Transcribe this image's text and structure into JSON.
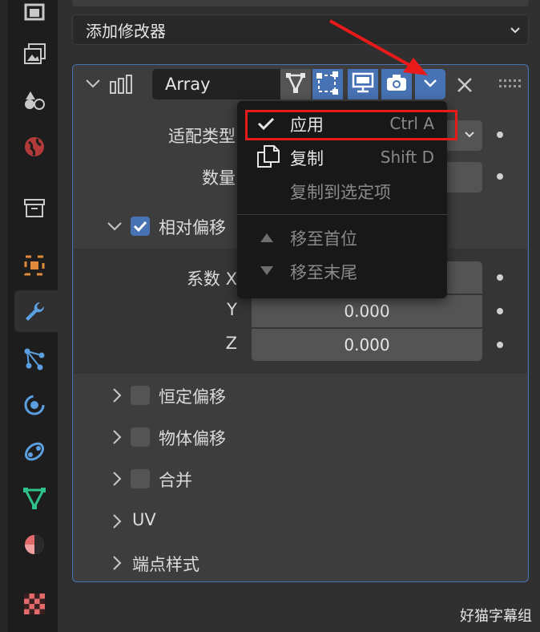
{
  "add_modifier": {
    "label": "添加修改器"
  },
  "modifier": {
    "name": "Array",
    "icons": [
      "edit-mode-icon",
      "on-cage-icon",
      "viewport-icon",
      "render-icon"
    ]
  },
  "fields": {
    "fit_type_label": "适配类型",
    "count_label": "数量",
    "relative_offset_label": "相对偏移",
    "factor_x_label": "系数 X",
    "y_label": "Y",
    "z_label": "Z",
    "y_value": "0.000",
    "z_value": "0.000",
    "relative_offset_checked": true
  },
  "sections": [
    {
      "label": "恒定偏移",
      "has_checkbox": true,
      "checked": false
    },
    {
      "label": "物体偏移",
      "has_checkbox": true,
      "checked": false
    },
    {
      "label": "合并",
      "has_checkbox": true,
      "checked": false
    },
    {
      "label": "UV",
      "has_checkbox": false
    },
    {
      "label": "端点样式",
      "has_checkbox": false
    }
  ],
  "menu": {
    "items": [
      {
        "label": "应用",
        "shortcut": "Ctrl A",
        "icon": "check-icon",
        "enabled": true
      },
      {
        "label": "复制",
        "shortcut": "Shift D",
        "icon": "duplicate-icon",
        "enabled": true
      },
      {
        "label": "复制到选定项",
        "shortcut": "",
        "icon": "",
        "enabled": false
      },
      {
        "label": "移至首位",
        "shortcut": "",
        "icon": "move-up-icon",
        "enabled": false
      },
      {
        "label": "移至末尾",
        "shortcut": "",
        "icon": "move-down-icon",
        "enabled": false
      }
    ]
  },
  "sidebar_icons": [
    "tool-icon",
    "render-properties-icon",
    "output-properties-icon",
    "view-layer-icon",
    "scene-icon",
    "world-icon",
    "collection-icon",
    "object-icon",
    "modifier-icon",
    "particles-icon",
    "physics-icon",
    "constraints-icon",
    "data-icon",
    "material-icon",
    "texture-icon"
  ],
  "watermark": "好猫字幕组",
  "colors": {
    "accent": "#4772b3",
    "highlight": "#e81a1a",
    "panel": "#3d3d3d",
    "menu": "#181818"
  }
}
